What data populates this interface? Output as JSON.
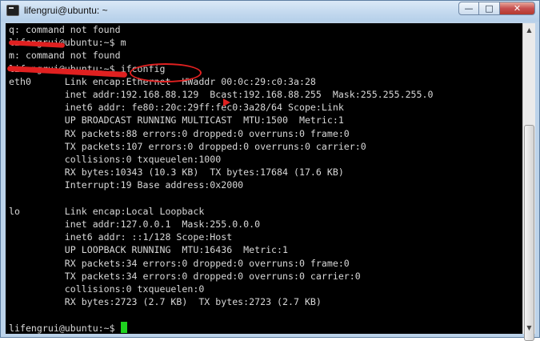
{
  "window": {
    "title": "lifengrui@ubuntu: ~",
    "buttons": {
      "minimize": "—",
      "maximize": "□",
      "close": "✕"
    }
  },
  "terminal": {
    "lines": [
      "q: command not found",
      "lifengrui@ubuntu:~$ m",
      "m: command not found",
      "lifengrui@ubuntu:~$ ifconfig",
      "eth0      Link encap:Ethernet  HWaddr 00:0c:29:c0:3a:28",
      "          inet addr:192.168.88.129  Bcast:192.168.88.255  Mask:255.255.255.0",
      "          inet6 addr: fe80::20c:29ff:fec0:3a28/64 Scope:Link",
      "          UP BROADCAST RUNNING MULTICAST  MTU:1500  Metric:1",
      "          RX packets:88 errors:0 dropped:0 overruns:0 frame:0",
      "          TX packets:107 errors:0 dropped:0 overruns:0 carrier:0",
      "          collisions:0 txqueuelen:1000",
      "          RX bytes:10343 (10.3 KB)  TX bytes:17684 (17.6 KB)",
      "          Interrupt:19 Base address:0x2000",
      "",
      "lo        Link encap:Local Loopback",
      "          inet addr:127.0.0.1  Mask:255.0.0.0",
      "          inet6 addr: ::1/128 Scope:Host",
      "          UP LOOPBACK RUNNING  MTU:16436  Metric:1",
      "          RX packets:34 errors:0 dropped:0 overruns:0 frame:0",
      "          TX packets:34 errors:0 dropped:0 overruns:0 carrier:0",
      "          collisions:0 txqueuelen:0",
      "          RX bytes:2723 (2.7 KB)  TX bytes:2723 (2.7 KB)",
      "",
      "lifengrui@ubuntu:~$ "
    ],
    "colors": {
      "background": "#000000",
      "text": "#d8d8d8",
      "cursor": "#1fd21f",
      "annotation": "#e02020"
    }
  },
  "icons": {
    "app": "terminal-icon",
    "scroll_up": "scroll-up-arrow-icon",
    "scroll_down": "scroll-down-arrow-icon"
  }
}
